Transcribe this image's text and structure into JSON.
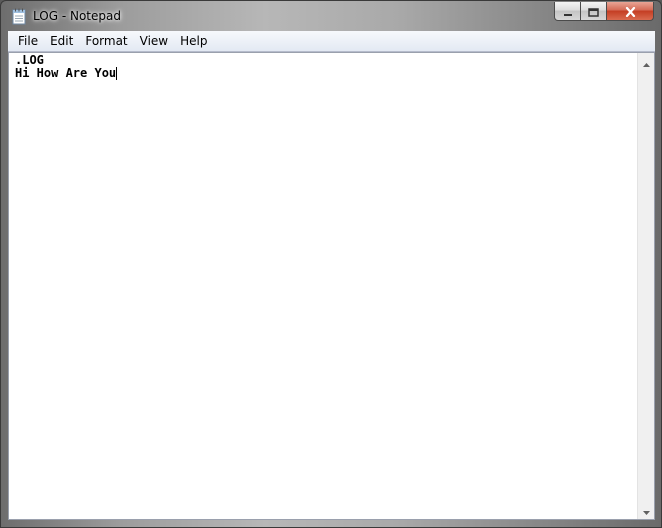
{
  "window": {
    "title": "LOG - Notepad",
    "icon": "notepad-icon",
    "caption_buttons": [
      "minimize-icon",
      "maximize-icon",
      "close-icon"
    ]
  },
  "menu": {
    "items": [
      {
        "label": "File"
      },
      {
        "label": "Edit"
      },
      {
        "label": "Format"
      },
      {
        "label": "View"
      },
      {
        "label": "Help"
      }
    ]
  },
  "editor": {
    "lines": [
      ".LOG",
      "Hi How Are You"
    ]
  },
  "scrollbar": {
    "up_icon": "scroll-up-arrow-icon",
    "down_icon": "scroll-down-arrow-icon"
  },
  "colors": {
    "menubar_top": "#f7f9fc",
    "menubar_bottom": "#e3e9f3",
    "close_button": "#c43d23",
    "editor_bg": "#ffffff"
  }
}
